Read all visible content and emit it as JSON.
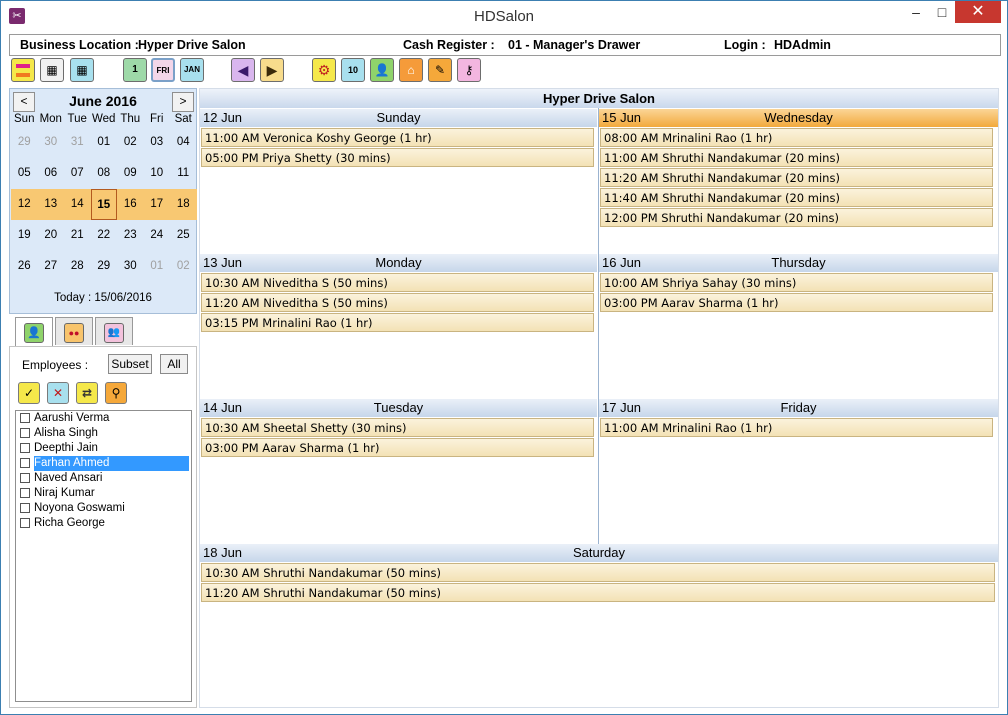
{
  "window": {
    "title": "HDSalon"
  },
  "info": {
    "business_label": "Business Location :",
    "business_value": "Hyper Drive Salon",
    "cash_label": "Cash Register :",
    "cash_value": "01 - Manager's Drawer",
    "login_label": "Login :",
    "login_value": "HDAdmin"
  },
  "calendar": {
    "month_title": "June 2016",
    "prev": "<",
    "next": ">",
    "weekdays": [
      "Sun",
      "Mon",
      "Tue",
      "Wed",
      "Thu",
      "Fri",
      "Sat"
    ],
    "weeks": [
      [
        "29",
        "30",
        "31",
        "01",
        "02",
        "03",
        "04"
      ],
      [
        "05",
        "06",
        "07",
        "08",
        "09",
        "10",
        "11"
      ],
      [
        "12",
        "13",
        "14",
        "15",
        "16",
        "17",
        "18"
      ],
      [
        "19",
        "20",
        "21",
        "22",
        "23",
        "24",
        "25"
      ],
      [
        "26",
        "27",
        "28",
        "29",
        "30",
        "01",
        "02"
      ]
    ],
    "today_text": "Today : 15/06/2016"
  },
  "employees": {
    "label": "Employees :",
    "subset": "Subset",
    "all": "All",
    "items": [
      "Aarushi Verma",
      "Alisha Singh",
      "Deepthi Jain",
      "Farhan Ahmed",
      "Naved Ansari",
      "Niraj Kumar",
      "Noyona Goswami",
      "Richa George"
    ],
    "selected": "Farhan Ahmed"
  },
  "schedule": {
    "title": "Hyper Drive Salon",
    "days": {
      "sun": {
        "date": "12 Jun",
        "name": "Sunday",
        "appts": [
          "11:00 AM Veronica Koshy George (1 hr)",
          "05:00 PM Priya Shetty (30 mins)"
        ]
      },
      "wed": {
        "date": "15 Jun",
        "name": "Wednesday",
        "appts": [
          "08:00 AM Mrinalini Rao (1 hr)",
          "11:00 AM Shruthi Nandakumar (20 mins)",
          "11:20 AM Shruthi Nandakumar (20 mins)",
          "11:40 AM Shruthi Nandakumar (20 mins)",
          "12:00 PM Shruthi Nandakumar (20 mins)"
        ]
      },
      "mon": {
        "date": "13 Jun",
        "name": "Monday",
        "appts": [
          "10:30 AM Niveditha S (50 mins)",
          "11:20 AM Niveditha S (50 mins)",
          "03:15 PM Mrinalini Rao (1 hr)"
        ]
      },
      "thu": {
        "date": "16 Jun",
        "name": "Thursday",
        "appts": [
          "10:00 AM Shriya Sahay (30 mins)",
          "03:00 PM Aarav Sharma (1 hr)"
        ]
      },
      "tue": {
        "date": "14 Jun",
        "name": "Tuesday",
        "appts": [
          "10:30 AM Sheetal Shetty (30 mins)",
          "03:00 PM Aarav Sharma (1 hr)"
        ]
      },
      "fri": {
        "date": "17 Jun",
        "name": "Friday",
        "appts": [
          "11:00 AM Mrinalini Rao (1 hr)"
        ]
      },
      "sat": {
        "date": "18 Jun",
        "name": "Saturday",
        "appts": [
          "10:30 AM Shruthi Nandakumar (50 mins)",
          "11:20 AM Shruthi Nandakumar (50 mins)"
        ]
      }
    }
  }
}
